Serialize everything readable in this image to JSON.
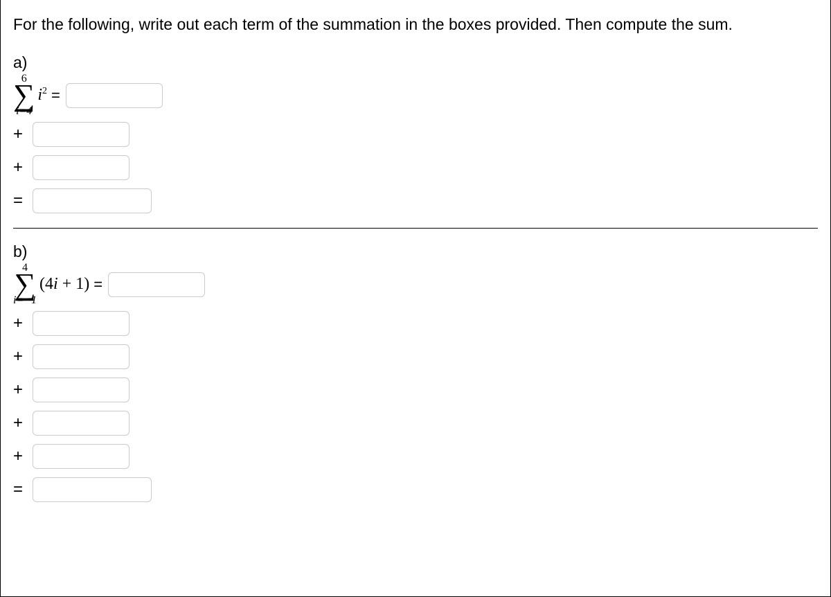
{
  "instructions": "For the following, write out each term of the summation in the boxes provided. Then compute the sum.",
  "partA": {
    "label": "a)",
    "upper": "6",
    "lower": "i=4",
    "expr_i": "i",
    "expr_sup": "2",
    "equals": "=",
    "terms": [
      {
        "op": "+",
        "value": ""
      },
      {
        "op": "+",
        "value": ""
      }
    ],
    "result_op": "=",
    "first_value": "",
    "result_value": ""
  },
  "partB": {
    "label": "b)",
    "upper": "4",
    "lower": "i=−1",
    "expr_text": "(4i + 1)",
    "equals": "=",
    "terms": [
      {
        "op": "+",
        "value": ""
      },
      {
        "op": "+",
        "value": ""
      },
      {
        "op": "+",
        "value": ""
      },
      {
        "op": "+",
        "value": ""
      },
      {
        "op": "+",
        "value": ""
      }
    ],
    "result_op": "=",
    "first_value": "",
    "result_value": ""
  }
}
